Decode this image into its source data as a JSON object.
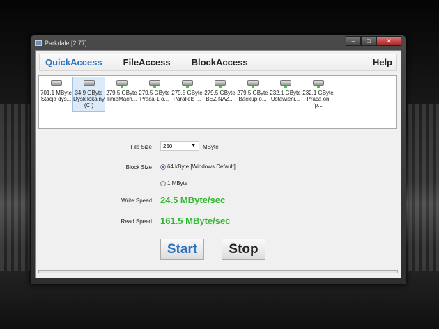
{
  "window": {
    "title": "Parkdale [2.77]"
  },
  "tabs": [
    {
      "label": "QuickAccess",
      "active": true
    },
    {
      "label": "FileAccess"
    },
    {
      "label": "BlockAccess"
    },
    {
      "label": "Help"
    }
  ],
  "drives": [
    {
      "size": "701.1 MByte",
      "name": "Stacja dys...",
      "icon": "optical-drive-icon"
    },
    {
      "size": "34.9 GByte",
      "name": "Dysk lokalny (C:)",
      "icon": "hard-drive-icon",
      "selected": true
    },
    {
      "size": "279.5 GByte",
      "name": "TimeMach...",
      "icon": "network-drive-icon"
    },
    {
      "size": "279.5 GByte",
      "name": "Praca-1 o...",
      "icon": "network-drive-icon"
    },
    {
      "size": "279.5 GByte",
      "name": "Parallels ...",
      "icon": "network-drive-icon"
    },
    {
      "size": "279.5 GByte",
      "name": "BEZ NAZ...",
      "icon": "network-drive-icon"
    },
    {
      "size": "279.5 GByte",
      "name": "Backup o...",
      "icon": "network-drive-icon"
    },
    {
      "size": "232.1 GByte",
      "name": "Ustawieni...",
      "icon": "network-drive-icon"
    },
    {
      "size": "232.1 GByte",
      "name": "Praca on 'p...",
      "icon": "network-drive-icon"
    }
  ],
  "form": {
    "file_size_label": "File Size",
    "file_size_value": "250",
    "file_size_unit": "MByte",
    "block_size_label": "Block Size",
    "block_option_1": "64 kByte [Windows Default]",
    "block_option_2": "1 MByte",
    "write_speed_label": "Write Speed",
    "write_speed": "24.5 MByte/sec",
    "read_speed_label": "Read Speed",
    "read_speed": "161.5 MByte/sec"
  },
  "buttons": {
    "start": "Start",
    "stop": "Stop"
  },
  "colors": {
    "accent": "#2a72c4",
    "speed": "#2eb82e"
  },
  "progress": 0
}
